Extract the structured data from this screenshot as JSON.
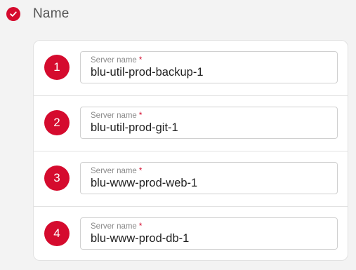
{
  "section": {
    "title": "Name",
    "status_icon": "check-circle-icon",
    "accent_color": "#d50b2e"
  },
  "servers": [
    {
      "number": "1",
      "label": "Server name",
      "required_mark": "*",
      "value": "blu-util-prod-backup-1"
    },
    {
      "number": "2",
      "label": "Server name",
      "required_mark": "*",
      "value": "blu-util-prod-git-1"
    },
    {
      "number": "3",
      "label": "Server name",
      "required_mark": "*",
      "value": "blu-www-prod-web-1"
    },
    {
      "number": "4",
      "label": "Server name",
      "required_mark": "*",
      "value": "blu-www-prod-db-1"
    }
  ]
}
